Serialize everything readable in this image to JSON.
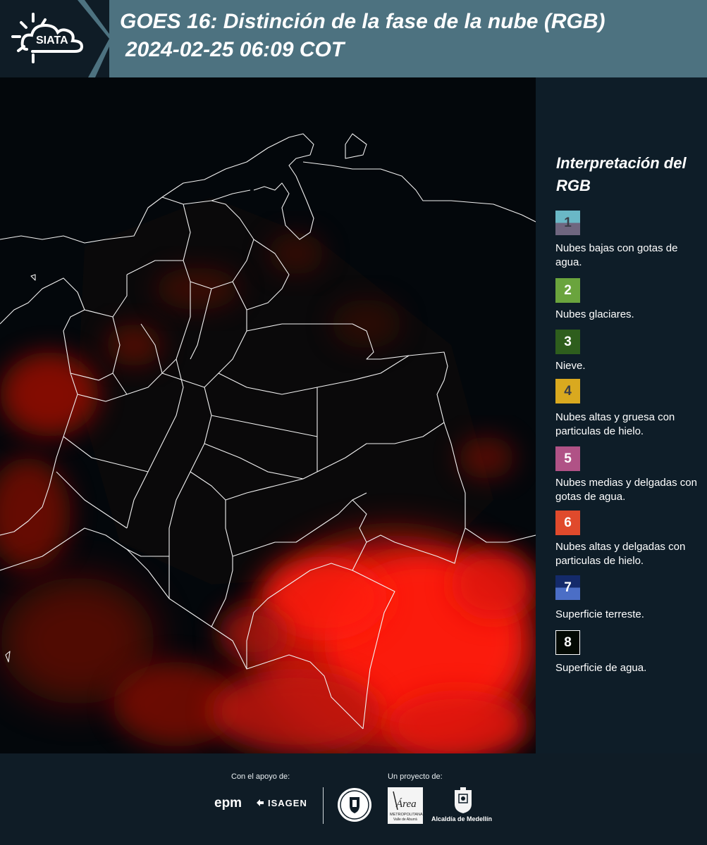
{
  "header": {
    "logo_text": "SIATA",
    "title_line1": "GOES 16: Distinción de la fase de la nube (RGB)",
    "title_line2": "2024-02-25 06:09 COT"
  },
  "legend": {
    "title": "Interpretación del RGB",
    "items": [
      {
        "number": "1",
        "label": "Nubes bajas con gotas de agua.",
        "color_top": "#6ab8c6",
        "color_bottom": "#6f667f",
        "text_color": "#3a3d47"
      },
      {
        "number": "2",
        "label": "Nubes glaciares.",
        "color": "#6aa43d",
        "text_color": "#ffffff"
      },
      {
        "number": "3",
        "label": "Nieve.",
        "color": "#2e5e1d",
        "text_color": "#ffffff"
      },
      {
        "number": "4",
        "label": "Nubes altas y gruesa con particulas de hielo.",
        "color": "#d9a91f",
        "text_color": "#3a3d47"
      },
      {
        "number": "5",
        "label": "Nubes medias y delgadas con gotas de agua.",
        "color": "#b05286",
        "text_color": "#ffffff"
      },
      {
        "number": "6",
        "label": "Nubes altas y delgadas con particulas de hielo.",
        "color": "#e04a2c",
        "text_color": "#ffffff"
      },
      {
        "number": "7",
        "label": "Superficie terreste.",
        "color_top": "#142a6a",
        "color_bottom": "#4b6ec6",
        "text_color": "#ffffff"
      },
      {
        "number": "8",
        "label": "Superficie de agua.",
        "color": "#040a04",
        "border": "#ffffff",
        "text_color": "#ffffff"
      }
    ]
  },
  "footer": {
    "support_label": "Con el apoyo de:",
    "project_label": "Un proyecto de:",
    "sponsor_1": "epm",
    "sponsor_2": "ISAGEN",
    "area_logo_text": "Área",
    "area_logo_sub1": "METROPOLITANA",
    "area_logo_sub2": "Valle de Aburrá",
    "partner_3": "Alcaldía de Medellín"
  },
  "colors": {
    "header_bg": "#4d7280",
    "page_bg": "#0e1d28",
    "cloud_red": "#ff1a0d"
  },
  "icons": [
    "siata-sun-cloud-logo",
    "isagen-logo",
    "university-seal",
    "alcaldia-crest"
  ]
}
